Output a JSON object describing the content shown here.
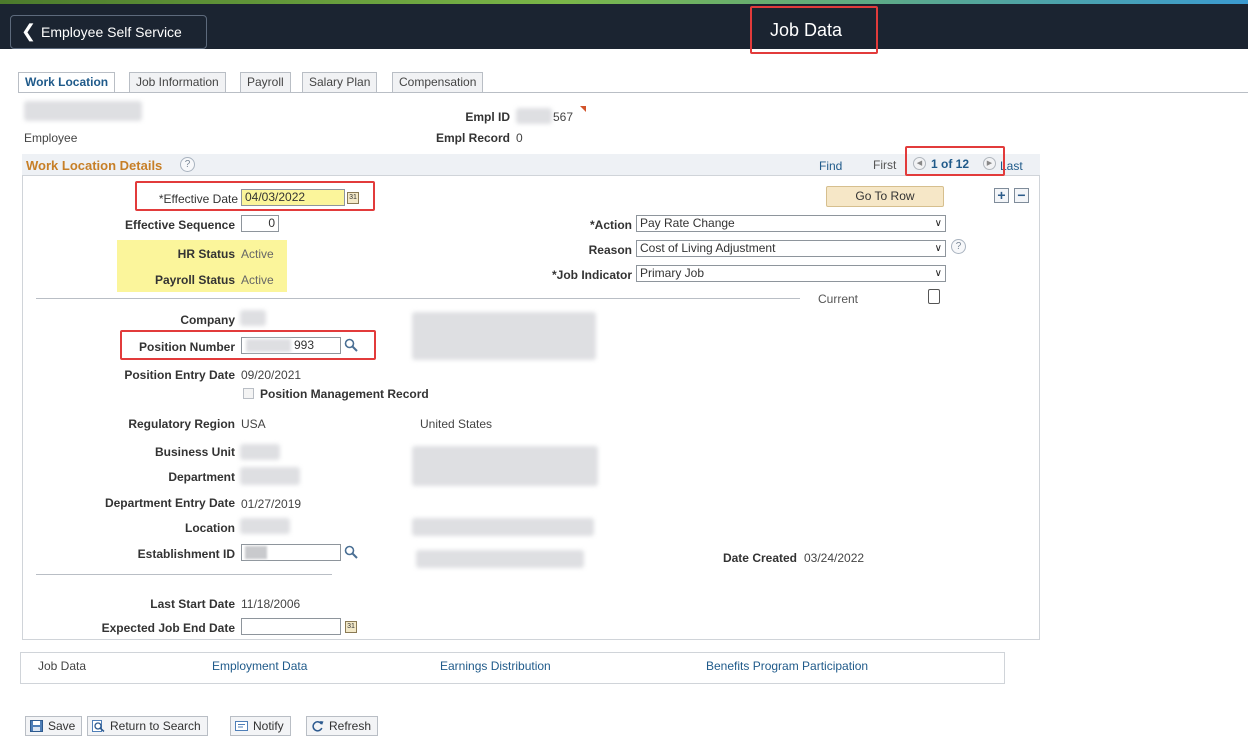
{
  "header": {
    "back_label": "Employee Self Service",
    "title": "Job Data"
  },
  "tabs": [
    {
      "label": "Work Location",
      "active": true
    },
    {
      "label": "Job Information",
      "active": false
    },
    {
      "label": "Payroll",
      "active": false
    },
    {
      "label": "Salary Plan",
      "active": false
    },
    {
      "label": "Compensation",
      "active": false
    }
  ],
  "employee": {
    "role_label": "Employee",
    "empl_id_label": "Empl ID",
    "empl_id_value": "567",
    "empl_record_label": "Empl Record",
    "empl_record_value": "0"
  },
  "section": {
    "title": "Work Location Details",
    "find": "Find",
    "first": "First",
    "count": "1 of 12",
    "last": "Last",
    "go_to_row": "Go To Row"
  },
  "fields": {
    "effective_date_label": "*Effective Date",
    "effective_date_value": "04/03/2022",
    "effective_sequence_label": "Effective Sequence",
    "effective_sequence_value": "0",
    "hr_status_label": "HR Status",
    "hr_status_value": "Active",
    "payroll_status_label": "Payroll Status",
    "payroll_status_value": "Active",
    "action_label": "*Action",
    "action_value": "Pay Rate Change",
    "reason_label": "Reason",
    "reason_value": "Cost of Living Adjustment",
    "job_indicator_label": "*Job Indicator",
    "job_indicator_value": "Primary Job",
    "current_label": "Current",
    "company_label": "Company",
    "position_number_label": "Position Number",
    "position_number_value": "993",
    "position_entry_date_label": "Position Entry Date",
    "position_entry_date_value": "09/20/2021",
    "position_mgmt_label": "Position Management Record",
    "regulatory_region_label": "Regulatory Region",
    "regulatory_region_value": "USA",
    "regulatory_region_desc": "United States",
    "business_unit_label": "Business Unit",
    "department_label": "Department",
    "dept_entry_date_label": "Department Entry Date",
    "dept_entry_date_value": "01/27/2019",
    "location_label": "Location",
    "establishment_id_label": "Establishment ID",
    "date_created_label": "Date Created",
    "date_created_value": "03/24/2022",
    "last_start_date_label": "Last Start Date",
    "last_start_date_value": "11/18/2006",
    "expected_end_date_label": "Expected Job End Date"
  },
  "footer_links": {
    "job_data": "Job Data",
    "employment_data": "Employment Data",
    "earnings_distribution": "Earnings Distribution",
    "benefits": "Benefits Program Participation"
  },
  "toolbar": {
    "save": "Save",
    "return_to_search": "Return to Search",
    "notify": "Notify",
    "refresh": "Refresh"
  },
  "colors": {
    "highlight": "#e23b3b",
    "header_bg": "#1b2431",
    "link": "#1f5a8a",
    "status_highlight": "#fbf59b"
  }
}
